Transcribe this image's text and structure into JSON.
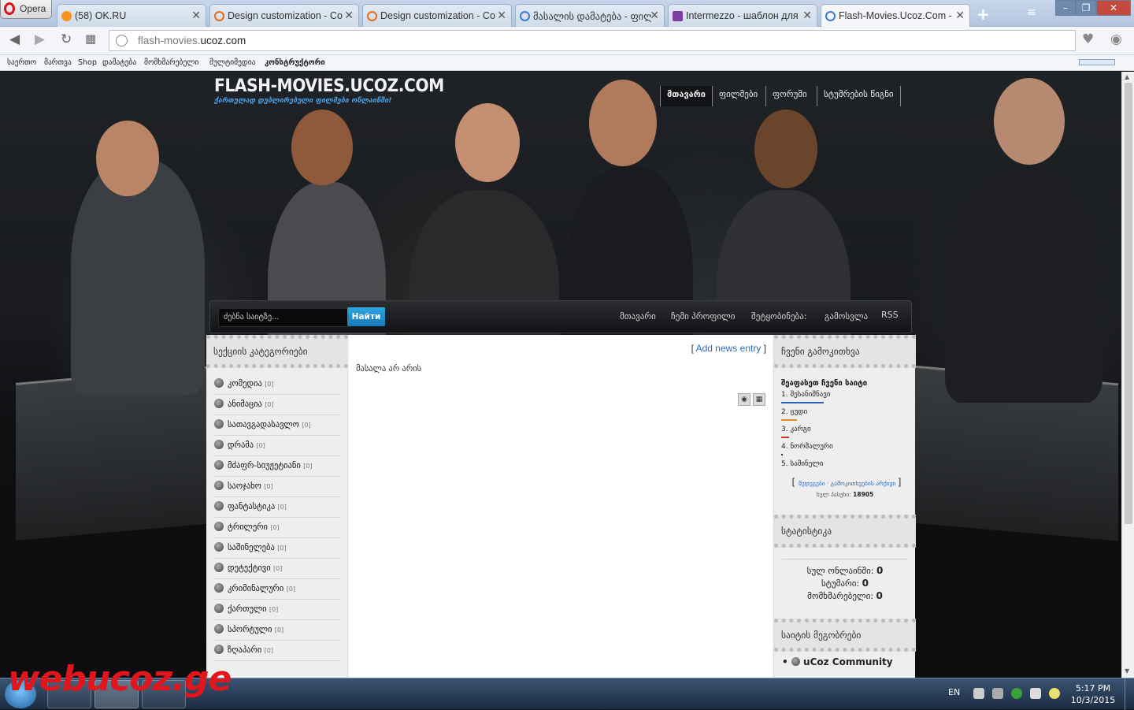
{
  "browser": {
    "menu_label": "Opera",
    "tabs": [
      {
        "label": "(58) OK.RU",
        "icon": "ok-icon",
        "color": "#f7931e"
      },
      {
        "label": "Design customization - Co",
        "icon": "ucoz-icon",
        "color": "#e56b1f"
      },
      {
        "label": "Design customization - Co",
        "icon": "ucoz-icon",
        "color": "#e56b1f"
      },
      {
        "label": "მასალის დამატება - ფილ",
        "icon": "ucoz-icon",
        "color": "#3a7bd5"
      },
      {
        "label": "Intermezzo - шаблон для",
        "icon": "template-icon",
        "color": "#7b3fa0"
      },
      {
        "label": "Flash-Movies.Ucoz.Com - ",
        "icon": "ucoz-icon",
        "color": "#3a7bd5"
      }
    ],
    "new_tab": "+",
    "url_prefix": "flash-movies.",
    "url_host": "ucoz.com",
    "bookmarks": [
      "საერთო",
      "მართვა",
      "Shop",
      "დამატება",
      "მომხმარებელი",
      "მულტიმედია",
      "კონსტრუქტორი"
    ]
  },
  "site": {
    "title": "FLASH-MOVIES.UCOZ.COM",
    "subtitle": "ქართულად დუბლირებული ფილმები ონლაინში!",
    "top_nav": [
      "მთავარი",
      "ფილმები",
      "ფორუმი",
      "სტუმრების წიგნი"
    ],
    "search": {
      "placeholder": "ძებნა საიტზე...",
      "button": "Найти"
    },
    "menu": [
      "მთავარი",
      "ჩემი პროფილი",
      "შეტყობინება:",
      "გამოსვლა",
      "RSS"
    ],
    "left_block": {
      "title": "სექციის კატეგორიები",
      "categories": [
        {
          "name": "კომედია",
          "count": "[0]"
        },
        {
          "name": "ანიმაცია",
          "count": "[0]"
        },
        {
          "name": "სათავგადასავლო",
          "count": "[0]"
        },
        {
          "name": "დრამა",
          "count": "[0]"
        },
        {
          "name": "მძაფრ-სიუჟეტიანი",
          "count": "[0]"
        },
        {
          "name": "საოჯახო",
          "count": "[0]"
        },
        {
          "name": "ფანტასტიკა",
          "count": "[0]"
        },
        {
          "name": "ტრილერი",
          "count": "[0]"
        },
        {
          "name": "საშინელება",
          "count": "[0]"
        },
        {
          "name": "დეტექტივი",
          "count": "[0]"
        },
        {
          "name": "კრიმინალური",
          "count": "[0]"
        },
        {
          "name": "ქართული",
          "count": "[0]"
        },
        {
          "name": "სპორტული",
          "count": "[0]"
        },
        {
          "name": "ზღაპარი",
          "count": "[0]"
        }
      ]
    },
    "center": {
      "add_news_open": "[ ",
      "add_news": "Add news entry",
      "add_news_close": " ]",
      "empty_text": "მასალა არ არის"
    },
    "poll": {
      "title": "ჩვენი გამოკითხვა",
      "question": "შეაფასეთ ჩვენი საიტი",
      "options": [
        {
          "label": "1. შესანიშნავი",
          "color": "#2f5fbf",
          "fraction": 0.6
        },
        {
          "label": "2. ცუდი",
          "color": "#e08a2a",
          "fraction": 0.22
        },
        {
          "label": "3. კარგი",
          "color": "#c0392b",
          "fraction": 0.11
        },
        {
          "label": "4. ნორმალური",
          "color": "#333333",
          "fraction": 0.02
        },
        {
          "label": "5. საშინელი",
          "color": "#999999",
          "fraction": 0.0
        }
      ],
      "link_results": "შედეგები",
      "link_archive": "გამოკითხვების არქივი",
      "total_label": "სულ პასუხი:",
      "total_value": "18905"
    },
    "stats": {
      "title": "სტატისტიკა",
      "lines": [
        {
          "label": "სულ ონლაინში:",
          "value": "0"
        },
        {
          "label": "სტუმარი:",
          "value": "0"
        },
        {
          "label": "მომხმარებელი:",
          "value": "0"
        }
      ]
    },
    "partners": {
      "title": "საიტის მეგობრები",
      "first": "uCoz Community"
    },
    "watermark": "webucoz.ge"
  },
  "taskbar": {
    "lang": "EN",
    "time": "5:17 PM",
    "date": "10/3/2015"
  }
}
